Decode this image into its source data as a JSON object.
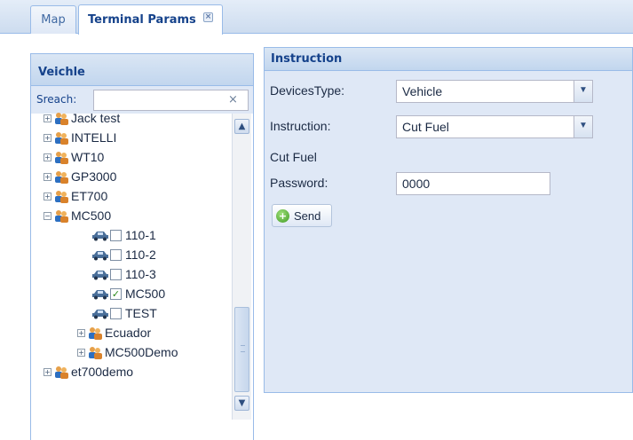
{
  "tabs": [
    {
      "label": "Map"
    },
    {
      "label": "Terminal Params",
      "close": "×"
    }
  ],
  "left_panel": {
    "title": "Veichle",
    "search_label": "Sreach:",
    "search_value": "",
    "search_clear": "×"
  },
  "tree": {
    "nodes": [
      {
        "label": "Jack test",
        "kind": "group",
        "expander": "+"
      },
      {
        "label": "INTELLI",
        "kind": "group",
        "expander": "+"
      },
      {
        "label": "WT10",
        "kind": "group",
        "expander": "+"
      },
      {
        "label": "GP3000",
        "kind": "group",
        "expander": "+"
      },
      {
        "label": "ET700",
        "kind": "group",
        "expander": "+"
      },
      {
        "label": "MC500",
        "kind": "group",
        "expander": "−"
      },
      {
        "label": "110-1",
        "kind": "vehicle",
        "checked": false
      },
      {
        "label": "110-2",
        "kind": "vehicle",
        "checked": false
      },
      {
        "label": "110-3",
        "kind": "vehicle",
        "checked": false
      },
      {
        "label": "MC500",
        "kind": "vehicle",
        "checked": true,
        "check": "✓"
      },
      {
        "label": "TEST",
        "kind": "vehicle",
        "checked": false
      },
      {
        "label": "Ecuador",
        "kind": "group",
        "expander": "+"
      },
      {
        "label": "MC500Demo",
        "kind": "group",
        "expander": "+"
      },
      {
        "label": "et700demo",
        "kind": "group",
        "expander": "+"
      }
    ]
  },
  "scrollbar": {
    "up": "▲",
    "down": "▼"
  },
  "instruction_panel": {
    "title": "Instruction",
    "devices_type_label": "DevicesType:",
    "devices_type_value": "Vehicle",
    "instruction_label": "Instruction:",
    "instruction_value": "Cut Fuel",
    "section_label": "Cut Fuel",
    "password_label": "Password:",
    "password_value": "0000",
    "send_label": "Send",
    "combo_arrow": "▼"
  },
  "colors": {
    "header_text": "#15428b",
    "panel_border": "#99bbe8",
    "panel_bg": "#dfe8f6"
  }
}
